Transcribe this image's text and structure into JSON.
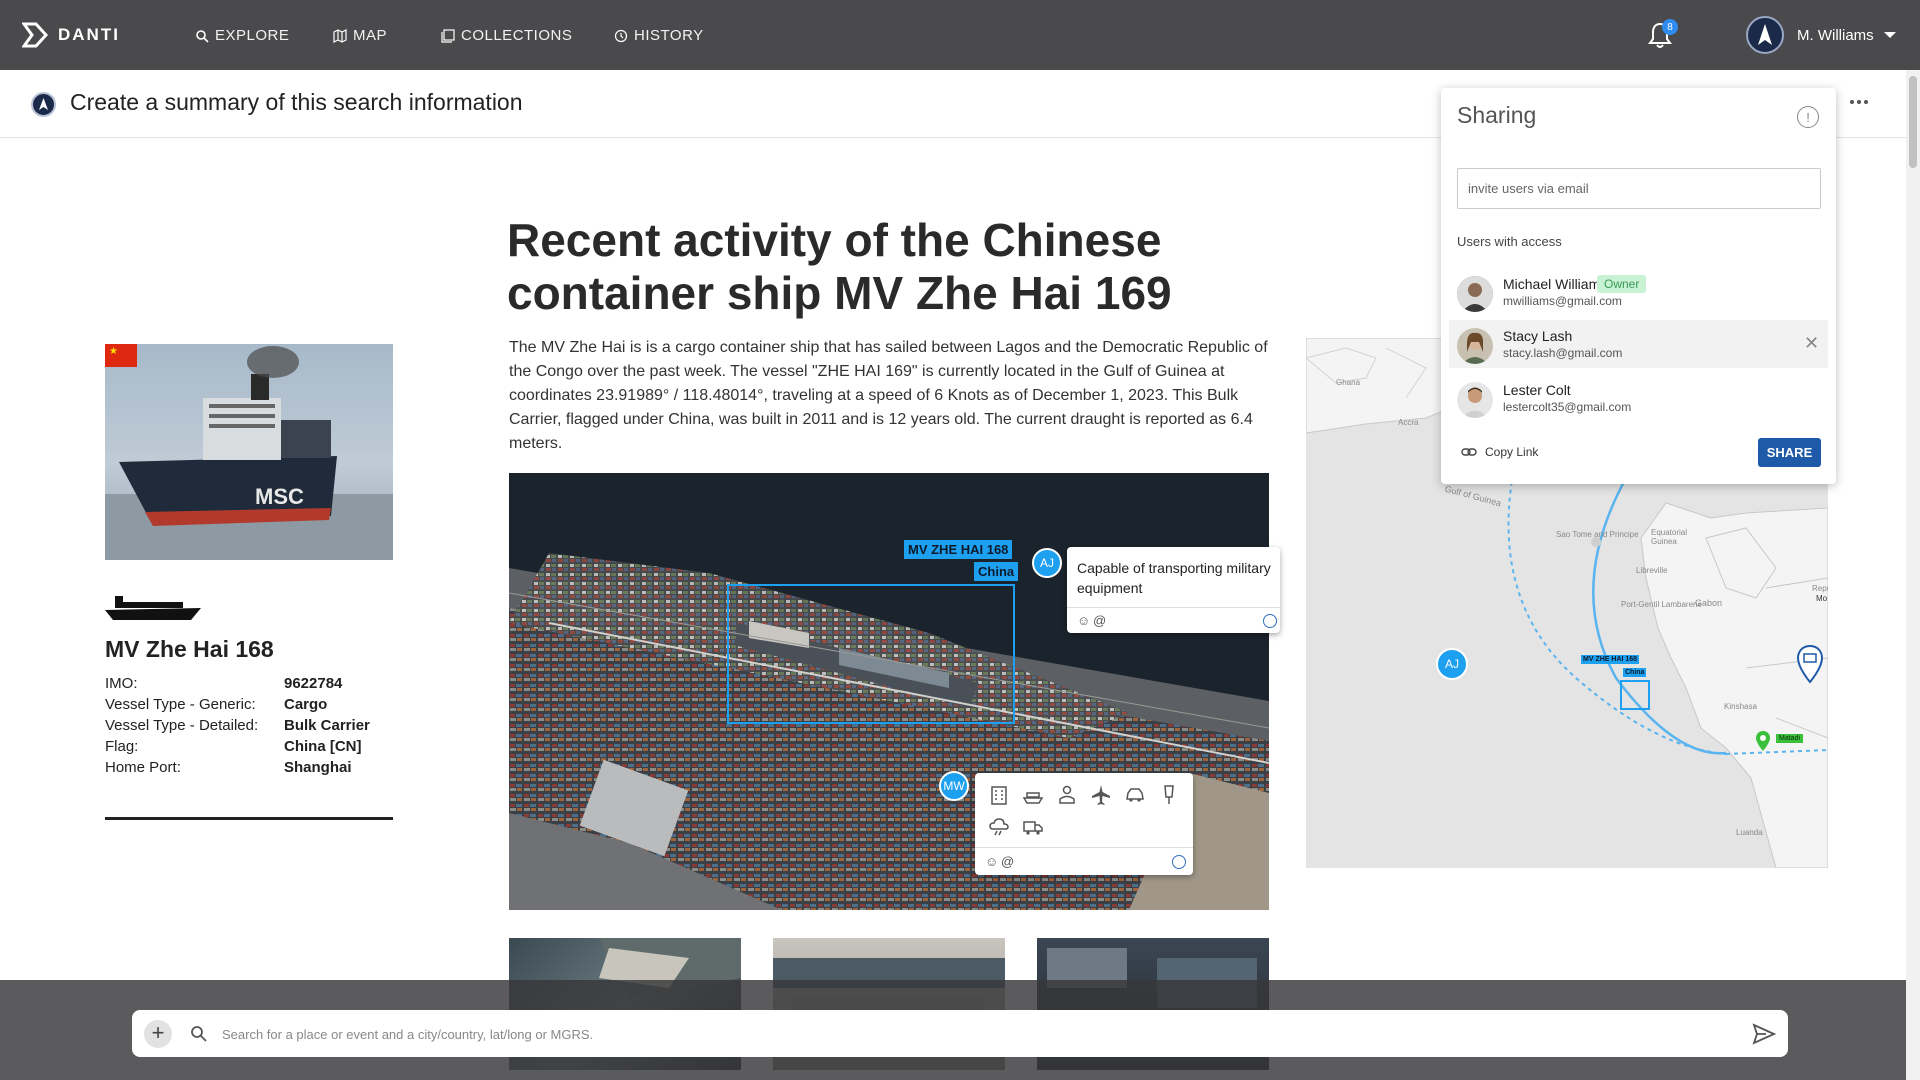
{
  "nav": {
    "brand": "DANTI",
    "items": [
      {
        "label": "EXPLORE",
        "icon": "search-icon"
      },
      {
        "label": "MAP",
        "icon": "map-icon"
      },
      {
        "label": "COLLECTIONS",
        "icon": "collections-icon"
      },
      {
        "label": "HISTORY",
        "icon": "history-icon"
      }
    ],
    "notification_count": "8",
    "user_name": "M. Williams"
  },
  "page": {
    "title": "Create a summary of this search information"
  },
  "vessel": {
    "name": "MV Zhe Hai 168",
    "props": [
      {
        "label": "IMO:",
        "value": "9622784"
      },
      {
        "label": "Vessel Type - Generic:",
        "value": "Cargo"
      },
      {
        "label": "Vessel Type - Detailed:",
        "value": "Bulk Carrier"
      },
      {
        "label": "Flag:",
        "value": "China [CN]"
      },
      {
        "label": "Home Port:",
        "value": "Shanghai"
      }
    ]
  },
  "article": {
    "headline": "Recent activity of the Chinese container ship MV Zhe Hai 169",
    "body": "The MV Zhe Hai is is a cargo container ship that has sailed between Lagos and the Democratic Republic of the Congo over the past week.  The vessel \"ZHE HAI 169\" is currently located in the Gulf of Guinea at coordinates 23.91989° / 118.48014°, traveling at a speed of 6 Knots as of December 1, 2023. This Bulk Carrier, flagged under China, was built in 2011 and is 12 years old. The current draught is reported as 6.4 meters."
  },
  "image_annotations": {
    "detection_name": "MV ZHE HAI 168",
    "detection_country": "China",
    "comment_user": "AJ",
    "comment_text": "Capable of transporting military equipment",
    "tag_user": "MW",
    "mention_symbol": "@"
  },
  "map": {
    "labels": [
      "Ghana",
      "Accra",
      "Gulf of Guinea",
      "Equatorial Guinea",
      "Sao Tome and Principe",
      "Libreville",
      "Port-Gentil Lambarene",
      "Gabon",
      "Kinshasa",
      "Luanda",
      "Repu",
      "Mo"
    ],
    "detection_name": "MV ZHE HAI 168",
    "detection_country": "China",
    "comment_user": "AJ",
    "pin_label": "Matadi"
  },
  "sharing": {
    "title": "Sharing",
    "invite_placeholder": "invite users via email",
    "users_heading": "Users with access",
    "users": [
      {
        "name": "Michael Williams",
        "email": "mwilliams@gmail.com",
        "badge": "Owner"
      },
      {
        "name": "Stacy Lash",
        "email": "stacy.lash@gmail.com"
      },
      {
        "name": "Lester Colt",
        "email": "lestercolt35@gmail.com"
      }
    ],
    "copy_link": "Copy Link",
    "share_button": "SHARE"
  },
  "search": {
    "placeholder": "Search for a place or event and a city/country, lat/long or MGRS."
  },
  "colors": {
    "topbar": "#4a4a4c",
    "accent": "#1ea0f0",
    "share_button": "#1f5aa8",
    "owner_badge": "#c9f2d4"
  }
}
